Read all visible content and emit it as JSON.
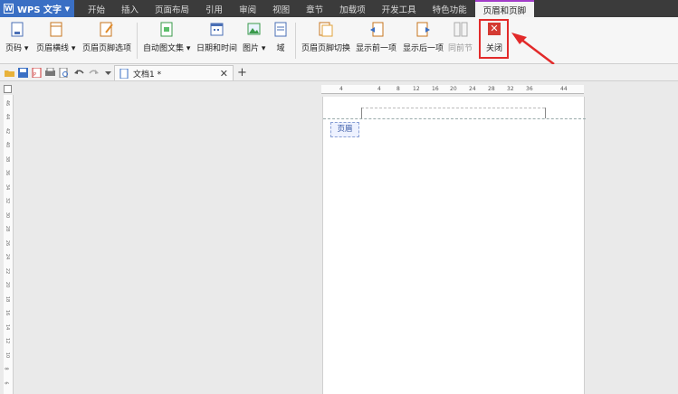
{
  "app": {
    "name": "WPS 文字"
  },
  "menu_tabs": [
    "开始",
    "插入",
    "页面布局",
    "引用",
    "审阅",
    "视图",
    "章节",
    "加载项",
    "开发工具",
    "特色功能",
    "页眉和页脚"
  ],
  "ribbon": {
    "page_number": "页码",
    "header_line": "页眉横线",
    "header_footer_options": "页眉页脚选项",
    "auto_text": "自动图文集",
    "date_time": "日期和时间",
    "picture": "图片",
    "field": "域",
    "switch_header_footer": "页眉页脚切换",
    "show_previous": "显示前一项",
    "show_next": "显示后一项",
    "same_as_previous": "同前节",
    "close": "关闭"
  },
  "document_tab": {
    "title": "文档1 *"
  },
  "ruler_ticks": [
    "4",
    "4",
    "8",
    "12",
    "16",
    "20",
    "24",
    "28",
    "32",
    "36",
    "44"
  ],
  "vertical_ruler_ticks": [
    "46",
    "44",
    "42",
    "40",
    "38",
    "36",
    "34",
    "32",
    "30",
    "28",
    "26",
    "24",
    "22",
    "20",
    "18",
    "16",
    "14",
    "12",
    "10",
    "8",
    "6"
  ],
  "page": {
    "header_label": "页眉"
  },
  "colors": {
    "accent": "#a23cc9",
    "highlight_box": "#e22a2a",
    "close_icon": "#d43a32",
    "app_blue": "#3a6fc4"
  }
}
